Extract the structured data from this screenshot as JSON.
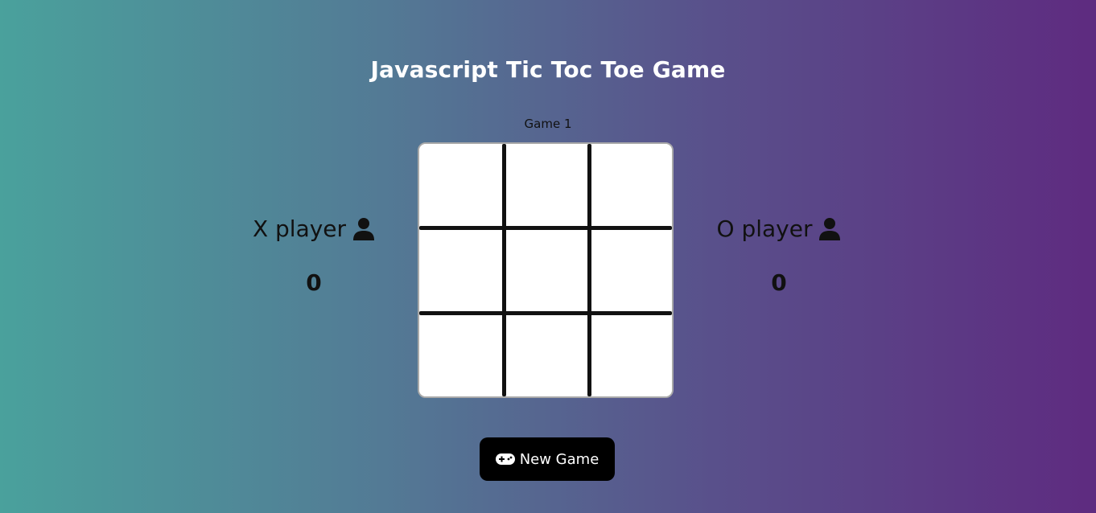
{
  "header": {
    "title": "Javascript Tic Toc Toe Game"
  },
  "game": {
    "label": "Game 1",
    "board": [
      "",
      "",
      "",
      "",
      "",
      "",
      "",
      "",
      ""
    ]
  },
  "players": {
    "x": {
      "name": "X player",
      "score": "0",
      "icon": "user-icon"
    },
    "o": {
      "name": "O player",
      "score": "0",
      "icon": "user-icon"
    }
  },
  "actions": {
    "new_game_label": "New Game",
    "new_game_icon": "gamepad-icon"
  },
  "colors": {
    "gradient_start": "#4aa19c",
    "gradient_end": "#5e2b80",
    "board_bg": "#ffffff",
    "grid_line": "#111111",
    "button_bg": "#000000"
  }
}
